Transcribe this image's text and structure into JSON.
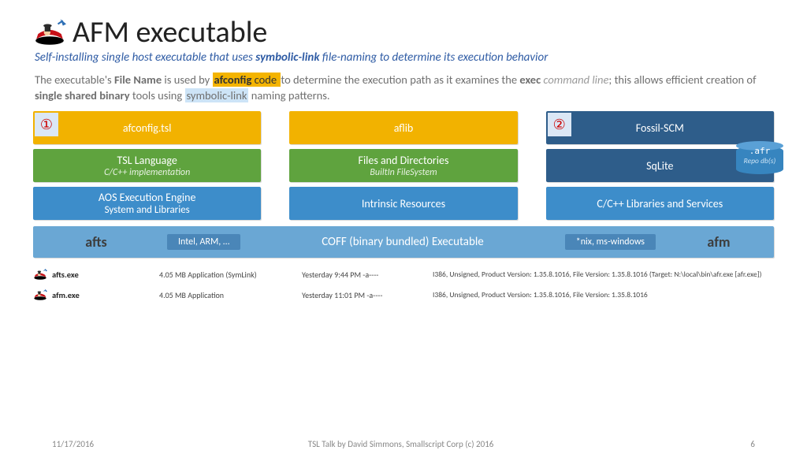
{
  "title": "AFM executable",
  "subtitle_parts": {
    "a": "Self-installing single host executable that uses ",
    "b": "symbolic-link",
    "c": " file-naming to determine its execution behavior"
  },
  "desc": {
    "a": "The executable's ",
    "b": "File Name",
    "c": " is used by ",
    "d": "afconfig",
    "e": " code ",
    "f": "to determine the execution path as it examines the ",
    "g": "exec",
    "h": "command line",
    "i": "; this allows efficient creation of ",
    "j": "single shared binary",
    "k": " tools using ",
    "l": "symbolic-link",
    "m": " naming patterns."
  },
  "col1": {
    "top": "afconfig.tsl",
    "badge": "①",
    "mid": "TSL Language",
    "mid_sub": "C/C++ implementation",
    "bot_a": "AOS Execution Engine",
    "bot_b": "System and Libraries"
  },
  "col2": {
    "top": "aflib",
    "mid": "Files and Directories",
    "mid_sub": "BuiltIn FileSystem",
    "bot": "Intrinsic Resources"
  },
  "col3": {
    "top": "Fossil-SCM",
    "badge": "②",
    "mid": "SqLite",
    "db": ".afr",
    "db2": "Repo db(s)",
    "bot": "C/C++ Libraries and Services"
  },
  "wide": {
    "left": "afts",
    "chip1": "Intel, ARM, …",
    "mid": "COFF (binary bundled) Executable",
    "chip2": "*nix, ms-windows",
    "right": "afm"
  },
  "files": [
    {
      "name": "afts.exe",
      "size": "4.05 MB  Application (SymLink)",
      "date": "Yesterday    9:44 PM    -a----",
      "meta": "I386, Unsigned, Product Version: 1.35.8.1016, File Version: 1.35.8.1016 (Target: N:\\local\\bin\\afr.exe [afr.exe])"
    },
    {
      "name": "afm.exe",
      "size": "4.05 MB  Application",
      "date": "Yesterday  11:01 PM    -a----",
      "meta": "I386, Unsigned, Product Version: 1.35.8.1016, File Version: 1.35.8.1016"
    }
  ],
  "footer": {
    "date": "11/17/2016",
    "center": "TSL Talk by David Simmons, Smallscript Corp (c) 2016",
    "page": "6"
  }
}
